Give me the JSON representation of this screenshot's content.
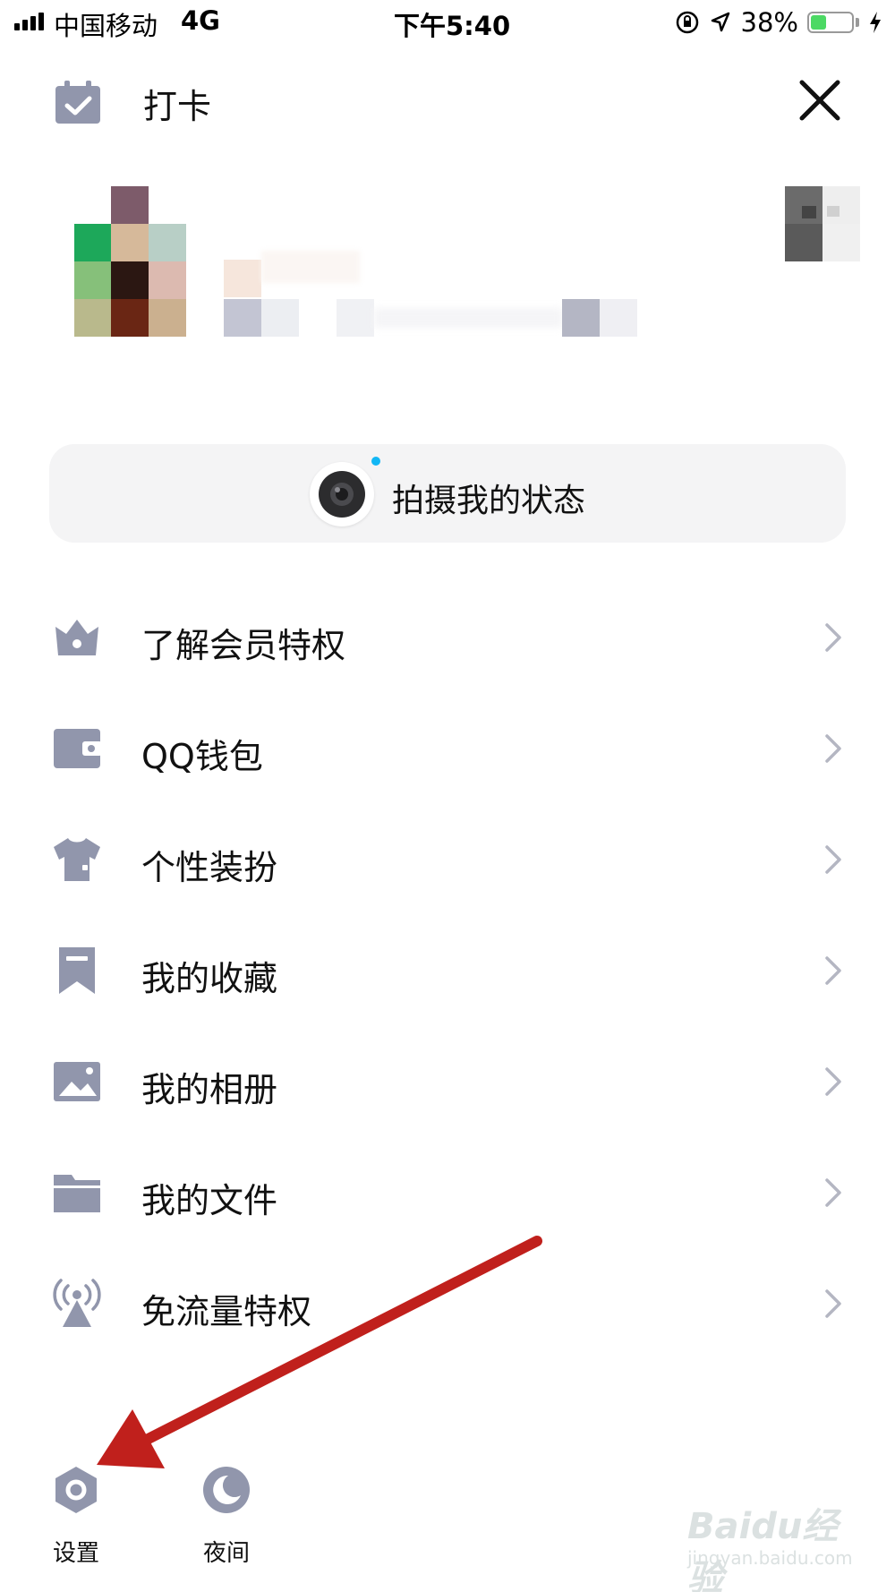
{
  "status_bar": {
    "carrier": "中国移动",
    "network": "4G",
    "time": "下午5:40",
    "battery": "38%",
    "battery_level": 0.38
  },
  "header": {
    "title": "打卡",
    "title_icon": "calendar-check-icon",
    "close_icon": "close-icon"
  },
  "capture": {
    "label": "拍摄我的状态",
    "icon": "camera-icon"
  },
  "menu": {
    "items": [
      {
        "label": "了解会员特权",
        "icon": "crown-icon"
      },
      {
        "label": "QQ钱包",
        "icon": "wallet-icon"
      },
      {
        "label": "个性装扮",
        "icon": "tshirt-icon"
      },
      {
        "label": "我的收藏",
        "icon": "bookmark-icon"
      },
      {
        "label": "我的相册",
        "icon": "image-icon"
      },
      {
        "label": "我的文件",
        "icon": "folder-icon"
      },
      {
        "label": "免流量特权",
        "icon": "signal-tower-icon"
      }
    ]
  },
  "bottom": {
    "settings_label": "设置",
    "night_label": "夜间"
  },
  "watermark": {
    "brand": "Baidu经验",
    "url": "jingyan.baidu.com"
  },
  "colors": {
    "icon": "#9196ac",
    "accent_dot": "#12b7f5",
    "annotation_arrow": "#c0201c"
  }
}
